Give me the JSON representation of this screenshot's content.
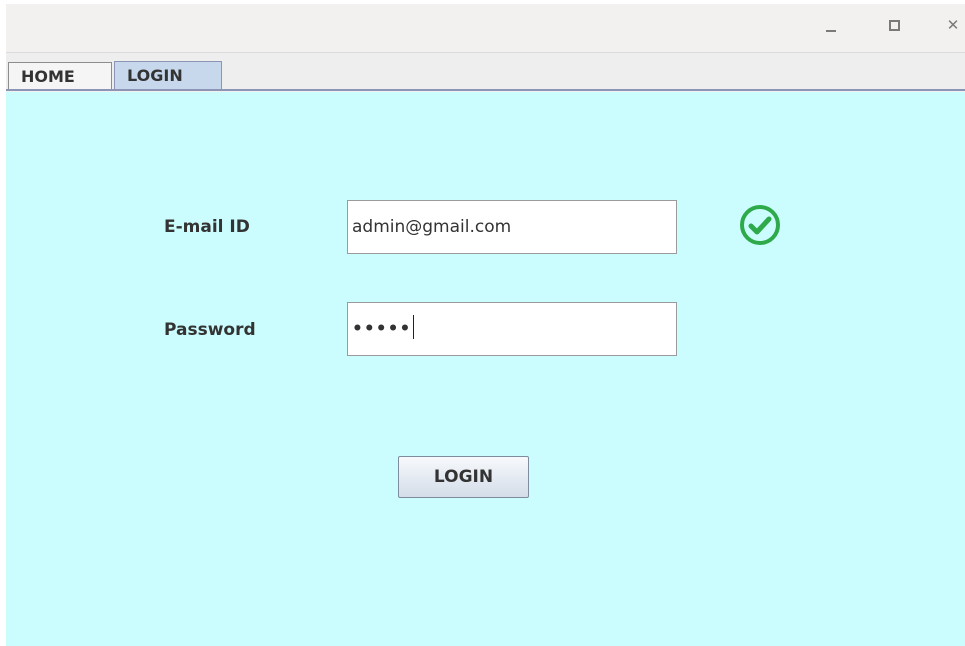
{
  "window": {
    "close_glyph": "✕"
  },
  "tabs": [
    {
      "label": "HOME",
      "selected": false
    },
    {
      "label": "LOGIN",
      "selected": true
    }
  ],
  "form": {
    "email_label": "E-mail ID",
    "email_value": "admin@gmail.com",
    "email_status_icon": "check-circle-icon",
    "password_label": "Password",
    "password_masked": "•••••",
    "login_button_label": "LOGIN"
  },
  "colors": {
    "content_background": "#ccfdfe",
    "selected_tab": "#c8d8ec",
    "valid_check": "#2eaa4a"
  }
}
